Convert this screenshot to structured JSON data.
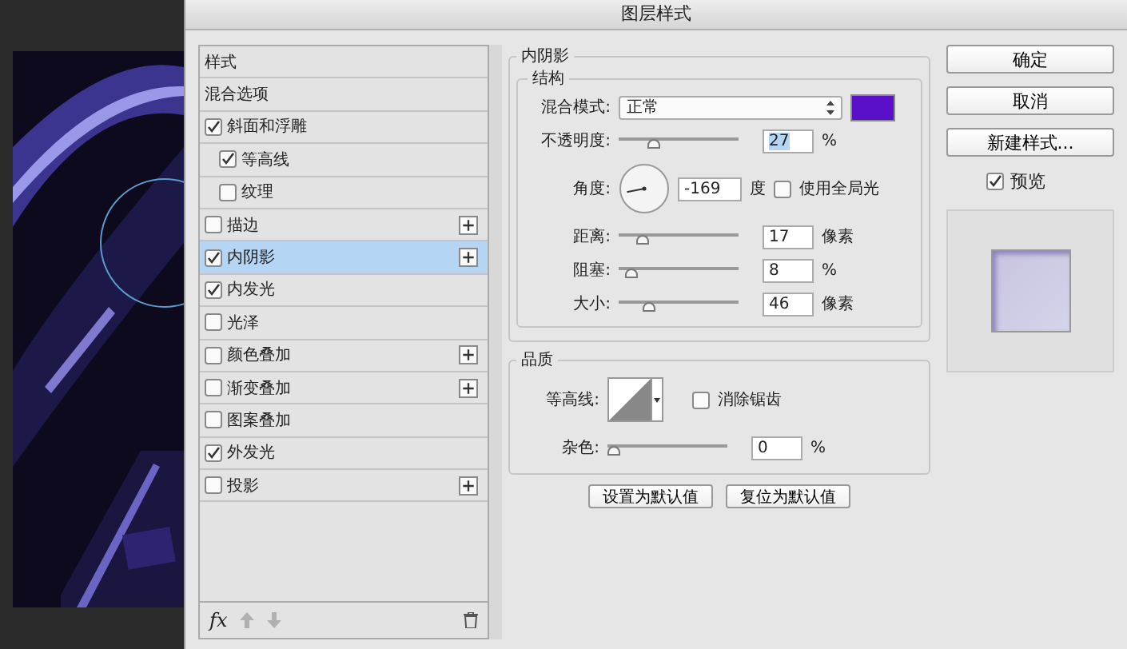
{
  "window": {
    "title": "图层样式"
  },
  "styles_list": {
    "items": [
      {
        "kind": "header",
        "label": "样式",
        "selected": false
      },
      {
        "kind": "plain",
        "label": "混合选项",
        "selected": false
      },
      {
        "kind": "check",
        "label": "斜面和浮雕",
        "checked": true,
        "selected": false,
        "plus": false,
        "children": [
          {
            "kind": "check",
            "label": "等高线",
            "checked": true,
            "selected": false,
            "plus": false
          },
          {
            "kind": "check",
            "label": "纹理",
            "checked": false,
            "selected": false,
            "plus": false
          }
        ]
      },
      {
        "kind": "check",
        "label": "描边",
        "checked": false,
        "selected": false,
        "plus": true
      },
      {
        "kind": "check",
        "label": "内阴影",
        "checked": true,
        "selected": true,
        "plus": true
      },
      {
        "kind": "check",
        "label": "内发光",
        "checked": true,
        "selected": false,
        "plus": false
      },
      {
        "kind": "check",
        "label": "光泽",
        "checked": false,
        "selected": false,
        "plus": false
      },
      {
        "kind": "check",
        "label": "颜色叠加",
        "checked": false,
        "selected": false,
        "plus": true
      },
      {
        "kind": "check",
        "label": "渐变叠加",
        "checked": false,
        "selected": false,
        "plus": true
      },
      {
        "kind": "check",
        "label": "图案叠加",
        "checked": false,
        "selected": false,
        "plus": false
      },
      {
        "kind": "check",
        "label": "外发光",
        "checked": true,
        "selected": false,
        "plus": false
      },
      {
        "kind": "check",
        "label": "投影",
        "checked": false,
        "selected": false,
        "plus": true
      }
    ],
    "footer": {
      "fx": "fx"
    }
  },
  "panel": {
    "title": "内阴影",
    "structure": {
      "title": "结构",
      "blend_mode": {
        "label": "混合模式:",
        "value": "正常",
        "color": "#5a0fc8"
      },
      "opacity": {
        "label": "不透明度:",
        "level": 0.27,
        "value": "27",
        "unit": "%"
      },
      "angle": {
        "label": "角度:",
        "value": "-169",
        "unit": "度",
        "global_light": {
          "label": "使用全局光",
          "checked": false
        }
      },
      "sliders": [
        {
          "label": "距离:",
          "level": 0.17,
          "value": "17",
          "unit": "像素"
        },
        {
          "label": "阻塞:",
          "level": 0.06,
          "value": "8",
          "unit": "%"
        },
        {
          "label": "大小:",
          "level": 0.22,
          "value": "46",
          "unit": "像素"
        }
      ]
    },
    "quality": {
      "title": "品质",
      "contour_label": "等高线:",
      "anti_alias": {
        "label": "消除锯齿",
        "checked": false
      },
      "noise": {
        "label": "杂色:",
        "level": 0.0,
        "value": "0",
        "unit": "%"
      }
    },
    "buttons": [
      "设置为默认值",
      "复位为默认值"
    ]
  },
  "side": {
    "buttons": [
      "确定",
      "取消",
      "新建样式..."
    ],
    "preview": {
      "label": "预览",
      "checked": true
    }
  }
}
